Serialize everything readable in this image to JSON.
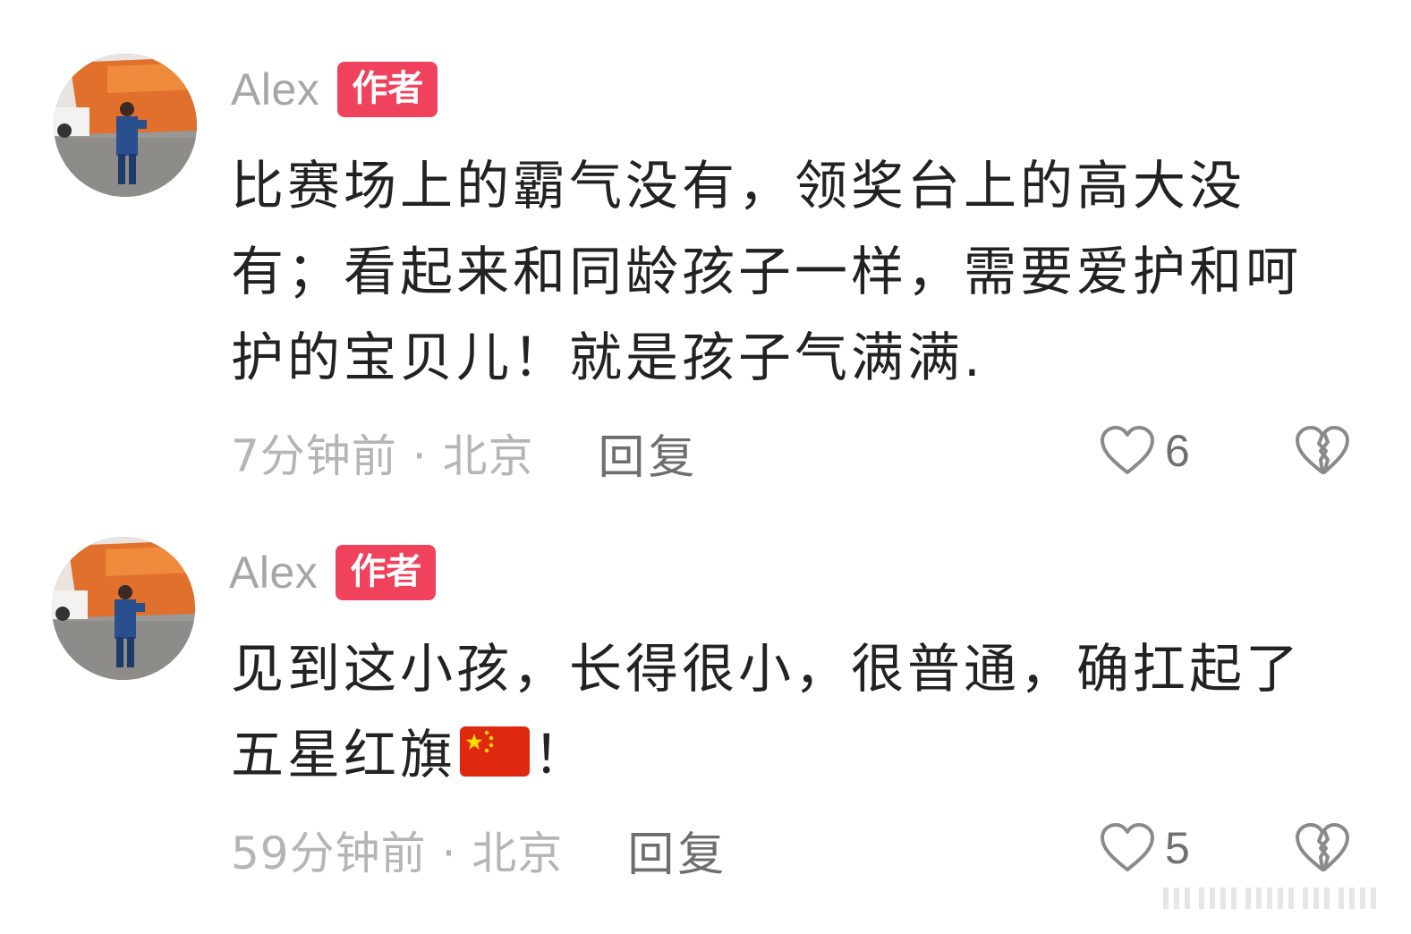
{
  "comments": [
    {
      "username": "Alex",
      "badge": "作者",
      "text": "比赛场上的霸气没有，领奖台上的高大没有；看起来和同龄孩子一样，需要爱护和呵护的宝贝儿！就是孩子气满满.",
      "time_location": "7分钟前 · 北京",
      "reply_label": "回复",
      "likes": "6",
      "like_icon": "heart-outline-icon",
      "dislike_icon": "broken-heart-icon"
    },
    {
      "username": "Alex",
      "badge": "作者",
      "text": "见到这小孩，长得很小，很普通，确扛起了五星红旗",
      "text_suffix": "！",
      "time_location": "59分钟前 · 北京",
      "reply_label": "回复",
      "likes": "5",
      "like_icon": "heart-outline-icon",
      "dislike_icon": "broken-heart-icon",
      "emoji": "china-flag-icon"
    }
  ],
  "colors": {
    "badge_bg": "#f0415d",
    "username": "#a6a6a6",
    "meta": "#b5b5b5",
    "reply": "#6e6e6e",
    "icon": "#8a8a8a"
  }
}
